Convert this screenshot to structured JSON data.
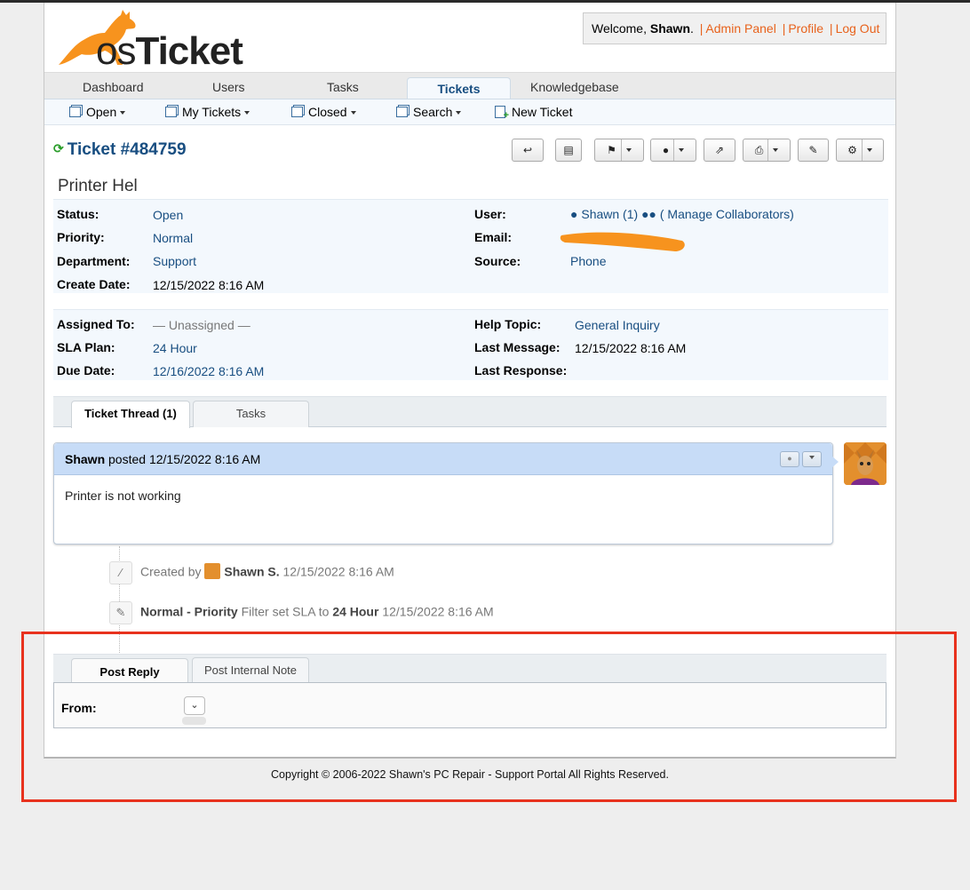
{
  "header": {
    "logo_text_os": "os",
    "logo_text_ticket": "Ticket",
    "welcome_prefix": "Welcome, ",
    "welcome_user": "Shawn",
    "welcome_suffix": ".",
    "sep": "|",
    "links": [
      "Admin Panel",
      "Profile",
      "Log Out"
    ]
  },
  "nav": {
    "tabs": [
      "Dashboard",
      "Users",
      "Tasks",
      "Tickets",
      "Knowledgebase"
    ],
    "active": "Tickets"
  },
  "subnav": {
    "items": [
      "Open",
      "My Tickets",
      "Closed",
      "Search",
      "New Ticket"
    ]
  },
  "ticket": {
    "number": "Ticket #484759",
    "subject": "Printer Hel",
    "status_label": "Status:",
    "status": "Open",
    "priority_label": "Priority:",
    "priority": "Normal",
    "department_label": "Department:",
    "department": "Support",
    "create_date_label": "Create Date:",
    "create_date": "12/15/2022 8:16 AM",
    "user_label": "User:",
    "user": "Shawn (1)",
    "collaborators": "( Manage Collaborators)",
    "email_label": "Email:",
    "source_label": "Source:",
    "source": "Phone",
    "assigned_label": "Assigned To:",
    "assigned": "— Unassigned —",
    "sla_label": "SLA Plan:",
    "sla": "24 Hour",
    "due_label": "Due Date:",
    "due": "12/16/2022 8:16 AM",
    "help_topic_label": "Help Topic:",
    "help_topic": "General Inquiry",
    "last_message_label": "Last Message:",
    "last_message": "12/15/2022 8:16 AM",
    "last_response_label": "Last Response:"
  },
  "thread_tabs": [
    "Ticket Thread (1)",
    "Tasks"
  ],
  "entry": {
    "author": "Shawn",
    "posted": "posted",
    "date": "12/15/2022 8:16 AM",
    "body": "Printer is not working"
  },
  "events": [
    {
      "prefix": "Created by",
      "who": "Shawn S.",
      "date": "12/15/2022 8:16 AM"
    },
    {
      "bold1": "Normal - Priority",
      "mid": "Filter set SLA to",
      "bold2": "24 Hour",
      "date": "12/15/2022 8:16 AM"
    }
  ],
  "reply_tabs": [
    "Post Reply",
    "Post Internal Note"
  ],
  "reply": {
    "from_label": "From:"
  },
  "footer": "Copyright © 2006-2022 Shawn's PC Repair - Support Portal All Rights Reserved.",
  "colors": {
    "brand_orange": "#e8621c",
    "link_blue": "#184e81",
    "highlight_red": "#e8321e",
    "redaction_orange": "#f7931e"
  }
}
